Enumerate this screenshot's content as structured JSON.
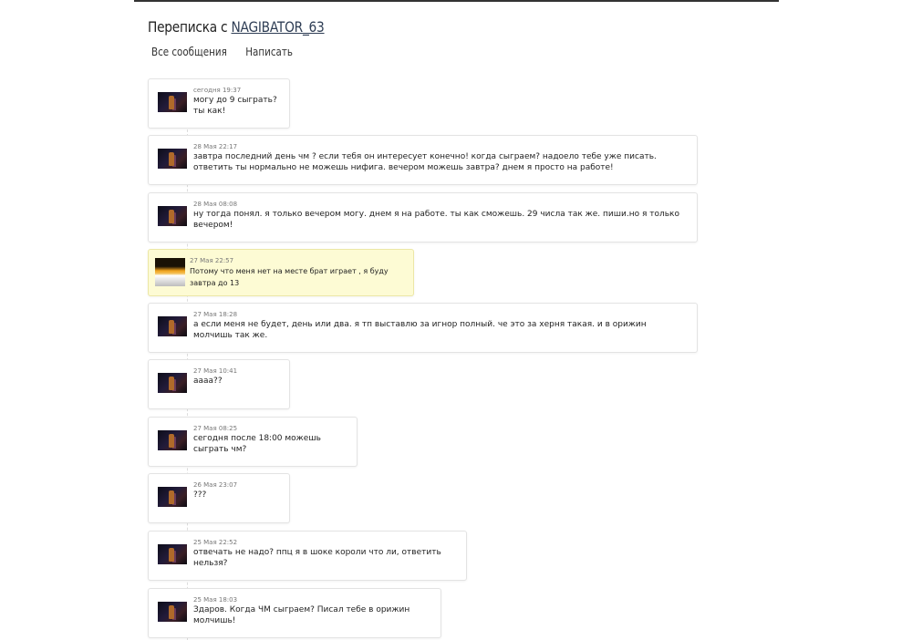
{
  "header": {
    "title_prefix": "Переписка с",
    "title_user": "NAGIBATOR_63"
  },
  "tabs": {
    "all_messages": "Все сообщения",
    "write": "Написать"
  },
  "messages": [
    {
      "time": "сегодня 19:37",
      "text": "могу до 9 сыграть? ты как!"
    },
    {
      "time": "28 Мая 22:17",
      "text": "завтра последний день чм ? если тебя он интересует конечно! когда сыграем? надоело тебе уже писать. ответить ты нормально не можешь нифига. вечером можешь завтра? днем я просто на работе!"
    },
    {
      "time": "28 Мая 08:08",
      "text": "ну тогда понял. я только вечером могу. днем я на работе. ты как сможешь. 29 числа так же. пиши.но я только вечером!"
    },
    {
      "time": "27 Мая 22:57",
      "text": "Потому что меня нет на месте брат играет , я буду завтра до 13"
    },
    {
      "time": "27 Мая 18:28",
      "text": "а если меня не будет, день или два. я тп выставлю за игнор полный. че это за херня такая. и в орижин молчишь так же."
    },
    {
      "time": "27 Мая 10:41",
      "text": "аааа??"
    },
    {
      "time": "27 Мая 08:25",
      "text": "сегодня после 18:00 можешь сыграть чм?"
    },
    {
      "time": "26 Мая 23:07",
      "text": "???"
    },
    {
      "time": "25 Мая 22:52",
      "text": "отвечать не надо? ппц я в шоке короли что ли, ответить нельзя?"
    },
    {
      "time": "25 Мая 18:03",
      "text": "Здаров. Когда ЧМ сыграем? Писал тебе в орижин молчишь!"
    }
  ]
}
